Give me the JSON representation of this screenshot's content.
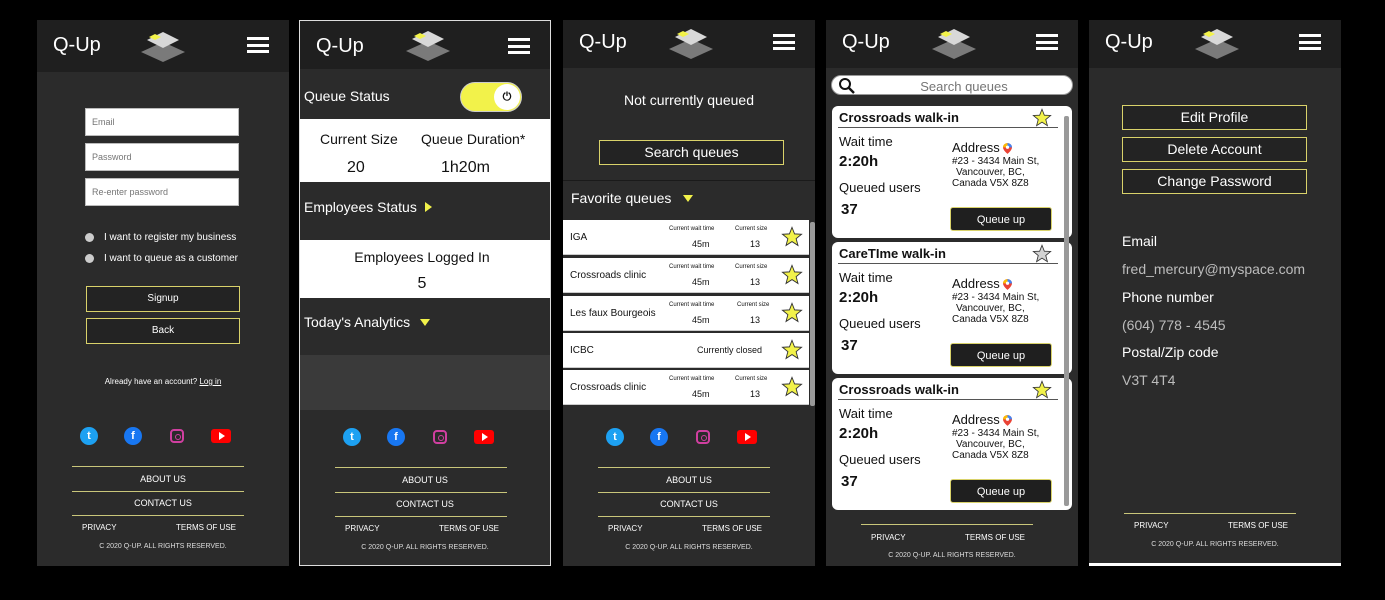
{
  "app": {
    "name": "Q-Up",
    "accent": "#f2f24a",
    "dark": "#2b2b2b"
  },
  "footer": {
    "about": "ABOUT US",
    "contact": "CONTACT US",
    "privacy": "PRIVACY",
    "terms": "TERMS OF USE",
    "copyright": "C 2020 Q-UP. ALL RIGHTS RESERVED."
  },
  "signup": {
    "email_placeholder": "Email",
    "password_placeholder": "Password",
    "reenter_placeholder": "Re-enter password",
    "option_business": "I want to register my business",
    "option_customer": "I want to queue as a customer",
    "signup_label": "Signup",
    "back_label": "Back",
    "have_account": "Already have an account?",
    "login_link": "Log in"
  },
  "business": {
    "queue_status": "Queue Status",
    "current_size_label": "Current Size",
    "current_size": "20",
    "duration_label": "Queue Duration*",
    "duration": "1h20m",
    "employees_status": "Employees Status",
    "employees_logged_label": "Employees Logged In",
    "employees_logged": "5",
    "analytics": "Today's Analytics"
  },
  "customer": {
    "status": "Not currently queued",
    "search_label": "Search queues",
    "favorites": "Favorite queues",
    "wait_label": "Current wait time",
    "size_label": "Current size",
    "closed_label": "Currently closed",
    "rows": [
      {
        "name": "IGA",
        "wait": "45m",
        "size": "13"
      },
      {
        "name": "Crossroads clinic",
        "wait": "45m",
        "size": "13"
      },
      {
        "name": "Les faux Bourgeois",
        "wait": "45m",
        "size": "13"
      },
      {
        "name": "ICBC"
      },
      {
        "name": "Crossroads clinic",
        "wait": "45m",
        "size": "13"
      }
    ]
  },
  "search": {
    "placeholder": "Search queues",
    "cards": [
      {
        "title": "Crossroads walk-in",
        "favorite": true,
        "wait_label": "Wait time",
        "wait": "2:20h",
        "users_label": "Queued users",
        "users": "37",
        "address_label": "Address",
        "address1": "#23 - 3434 Main St,",
        "address2": "Vancouver, BC,",
        "address3": "Canada  V5X 8Z8",
        "button": "Queue up"
      },
      {
        "title": "CareTIme walk-in",
        "favorite": false,
        "wait_label": "Wait time",
        "wait": "2:20h",
        "users_label": "Queued users",
        "users": "37",
        "address_label": "Address",
        "address1": "#23 - 3434 Main St,",
        "address2": "Vancouver, BC,",
        "address3": "Canada  V5X 8Z8",
        "button": "Queue up"
      },
      {
        "title": "Crossroads walk-in",
        "favorite": true,
        "wait_label": "Wait time",
        "wait": "2:20h",
        "users_label": "Queued users",
        "users": "37",
        "address_label": "Address",
        "address1": "#23 - 3434 Main St,",
        "address2": "Vancouver, BC,",
        "address3": "Canada  V5X 8Z8",
        "button": "Queue up"
      }
    ]
  },
  "profile": {
    "edit": "Edit Profile",
    "delete": "Delete Account",
    "change_pw": "Change Password",
    "email_label": "Email",
    "email": "fred_mercury@myspace.com",
    "phone_label": "Phone number",
    "phone": "(604) 778 - 4545",
    "postal_label": "Postal/Zip code",
    "postal": "V3T 4T4"
  }
}
